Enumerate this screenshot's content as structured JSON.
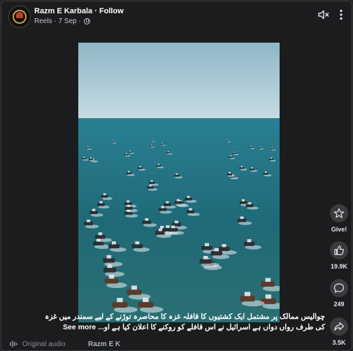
{
  "header": {
    "page_name": "Razm E Karbala",
    "separator": " · ",
    "follow_label": "Follow",
    "meta": "Reels · 7 Sep ·"
  },
  "icons": {
    "mute": "speaker-muted-icon",
    "more": "more-options-icon",
    "give": "give-star-icon",
    "like": "thumbs-up-icon",
    "comment": "comment-bubble-icon",
    "share": "share-arrow-icon",
    "audio": "audio-wave-icon",
    "privacy": "globe-icon"
  },
  "actions": {
    "give_label": "Give!",
    "likes": "19.9K",
    "comments": "249",
    "shares": "3.5K"
  },
  "caption": {
    "line1": "چوالیس ممالک پر مشتمل ایک کشتیوں کا قافلہ غزہ کا محاصرہ توڑنے کے لیے سمندر میں غزہ",
    "line2": "کی طرف رواں دواں ہے اسرائیل نے اس قافلے کو روکنے کا اعلان کیا ہے او...",
    "see_more": "See more"
  },
  "audio": {
    "label": "Original audio",
    "name": "Razm E K"
  },
  "colors": {
    "background": "#1b1c1e",
    "sea": "#1f6f80",
    "sky": "#b9d3dc"
  }
}
